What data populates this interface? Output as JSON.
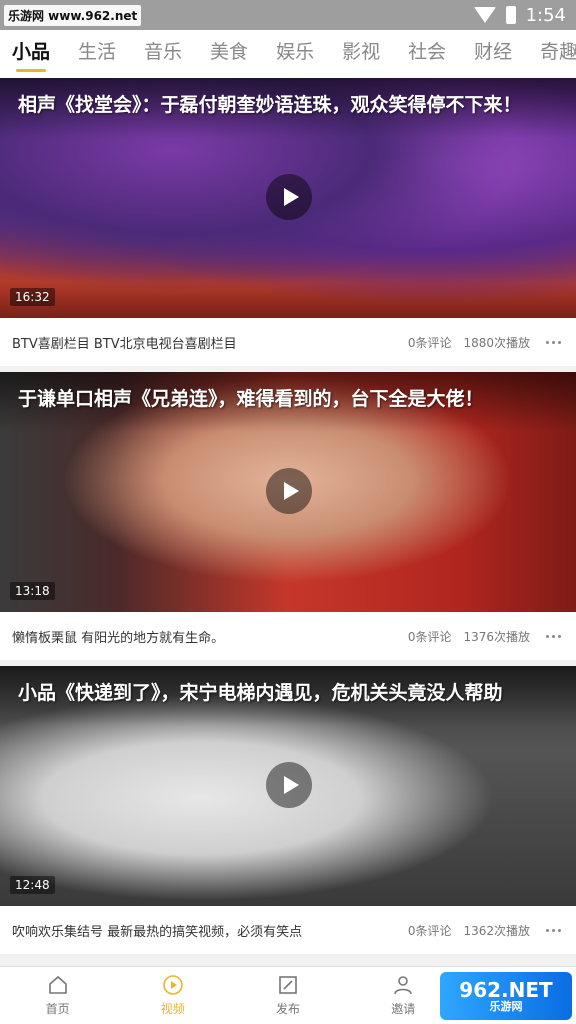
{
  "status_bar": {
    "watermark": "乐游网 www.962.net",
    "time": "1:54"
  },
  "tabs": [
    {
      "label": "小品",
      "active": true
    },
    {
      "label": "生活"
    },
    {
      "label": "音乐"
    },
    {
      "label": "美食"
    },
    {
      "label": "娱乐"
    },
    {
      "label": "影视"
    },
    {
      "label": "社会"
    },
    {
      "label": "财经"
    },
    {
      "label": "奇趣"
    }
  ],
  "videos": [
    {
      "title": "相声《找堂会》：于磊付朝奎妙语连珠，观众笑得停不下来！",
      "duration": "16:32",
      "description": "BTV喜剧栏目 BTV北京电视台喜剧栏目",
      "comments": "0条评论",
      "plays": "1880次播放"
    },
    {
      "title": "于谦单口相声《兄弟连》，难得看到的，台下全是大佬！",
      "duration": "13:18",
      "description": "懒惰板栗鼠 有阳光的地方就有生命。",
      "comments": "0条评论",
      "plays": "1376次播放"
    },
    {
      "title": "小品《快递到了》，宋宁电梯内遇见，危机关头竟没人帮助",
      "duration": "12:48",
      "description": "吹响欢乐集结号 最新最热的搞笑视频，必须有笑点",
      "comments": "0条评论",
      "plays": "1362次播放"
    }
  ],
  "bottom_nav": [
    {
      "label": "首页",
      "icon": "home-icon"
    },
    {
      "label": "视频",
      "icon": "video-play-icon",
      "active": true
    },
    {
      "label": "发布",
      "icon": "publish-icon"
    },
    {
      "label": "邀请",
      "icon": "invite-user-icon"
    }
  ],
  "watermark_br": {
    "big": "962.NET",
    "small": "乐游网"
  },
  "colors": {
    "accent": "#e7b62d"
  }
}
